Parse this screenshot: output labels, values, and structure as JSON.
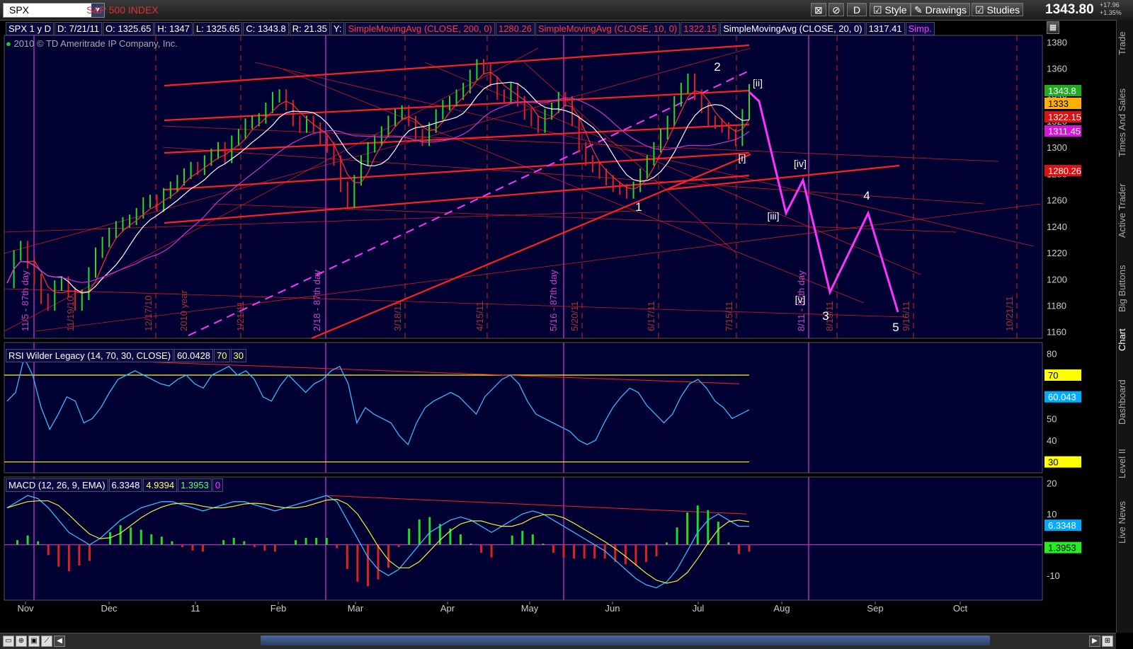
{
  "toolbar": {
    "symbol": "SPX",
    "symbol_name": "S&P 500 INDEX",
    "timeframe_button": "D",
    "style_label": "Style",
    "drawings_label": "Drawings",
    "studies_label": "Studies",
    "last_price": "1343.80",
    "change_abs": "+17.96",
    "change_pct": "+1.35%"
  },
  "header": {
    "symbol_tf": "SPX 1 y D",
    "date": "D: 7/21/11",
    "open": "O: 1325.65",
    "high": "H: 1347",
    "low": "L: 1325.65",
    "close": "C: 1343.8",
    "range": "R: 21.35",
    "y_label": "Y:",
    "sma200_label": "SimpleMovingAvg (CLOSE, 200, 0)",
    "sma200_value": "1280.26",
    "sma10_label": "SimpleMovingAvg (CLOSE, 10, 0)",
    "sma10_value": "1322.15",
    "sma20_label": "SimpleMovingAvg (CLOSE, 20, 0)",
    "sma20_value": "1317.41",
    "more_label": "Simp.",
    "copyright": "2010 © TD Ameritrade IP Company, Inc."
  },
  "rsi_header": {
    "label": "RSI Wilder Legacy (14, 70, 30, CLOSE)",
    "value": "60.0428",
    "ob": "70",
    "os": "30"
  },
  "macd_header": {
    "label": "MACD (12, 26, 9, EMA)",
    "v1": "6.3348",
    "v2": "4.9394",
    "v3": "1.3953",
    "v4": "0"
  },
  "right_tabs": [
    "Trade",
    "Times And Sales",
    "Active Trader",
    "Big Buttons",
    "Chart",
    "Dashboard",
    "Level II",
    "Live News"
  ],
  "price_axis": [
    "1380",
    "1360",
    "1340",
    "1320",
    "1300",
    "1280",
    "1260",
    "1240",
    "1220",
    "1200",
    "1180",
    "1160"
  ],
  "price_flags": [
    {
      "value": "1343.8",
      "color": "#22aa22"
    },
    {
      "value": "1333",
      "color": "#ffb000"
    },
    {
      "value": "1322.15",
      "color": "#dd1111"
    },
    {
      "value": "1311.45",
      "color": "#dd11dd"
    },
    {
      "value": "1280.26",
      "color": "#dd1111"
    }
  ],
  "rsi_axis": [
    "80",
    "70",
    "60",
    "50",
    "40",
    "30"
  ],
  "rsi_flags": [
    {
      "value": "70",
      "color": "#ffff00",
      "text": "#000"
    },
    {
      "value": "60.043",
      "color": "#00aaff",
      "text": "#fff"
    },
    {
      "value": "30",
      "color": "#ffff00",
      "text": "#000"
    }
  ],
  "macd_axis": [
    "20",
    "10",
    "-10"
  ],
  "macd_flags": [
    {
      "value": "6.3348",
      "color": "#00aaff",
      "text": "#fff"
    },
    {
      "value": "1.3953",
      "color": "#22ee22",
      "text": "#000"
    }
  ],
  "months": [
    "Nov",
    "Dec",
    "11",
    "Feb",
    "Mar",
    "Apr",
    "May",
    "Jun",
    "Jul",
    "Aug",
    "Sep",
    "Oct"
  ],
  "date_labels": [
    "11/5 - 87th day",
    "11/19/10",
    "12/17/10",
    "2010 year",
    "1/21/11",
    "2/18 - 87th day",
    "3/18/11",
    "4/15/11",
    "5/16 - 87th day",
    "5/20/11",
    "6/17/11",
    "7/15/11",
    "8/11 - 87th day",
    "8/19/11",
    "9/16/11",
    "10/21/11"
  ],
  "wave_labels": [
    "1",
    "2",
    "3",
    "4",
    "5",
    "[i]",
    "[ii]",
    "[iii]",
    "[iv]",
    "[v]"
  ],
  "colors": {
    "background": "#000033",
    "grid": "#3333aa",
    "trend": "#ff2020",
    "projection": "#ff33ff"
  },
  "chart_data": {
    "type": "line",
    "title": "SPX 1 y D",
    "xlabel": "",
    "ylabel": "",
    "ylim": [
      1155,
      1385
    ],
    "x_months": [
      "Nov",
      "Dec",
      "11",
      "Feb",
      "Mar",
      "Apr",
      "May",
      "Jun",
      "Jul",
      "Aug",
      "Sep",
      "Oct"
    ],
    "close_series": [
      1197,
      1218,
      1225,
      1212,
      1200,
      1185,
      1180,
      1195,
      1198,
      1190,
      1180,
      1188,
      1205,
      1220,
      1228,
      1235,
      1240,
      1243,
      1245,
      1250,
      1258,
      1260,
      1255,
      1265,
      1270,
      1275,
      1280,
      1285,
      1283,
      1290,
      1295,
      1300,
      1292,
      1305,
      1310,
      1318,
      1320,
      1322,
      1330,
      1338,
      1340,
      1332,
      1320,
      1315,
      1320,
      1315,
      1305,
      1300,
      1290,
      1270,
      1258,
      1275,
      1290,
      1300,
      1305,
      1312,
      1320,
      1325,
      1328,
      1320,
      1310,
      1305,
      1315,
      1325,
      1332,
      1335,
      1340,
      1345,
      1355,
      1363,
      1360,
      1350,
      1340,
      1338,
      1345,
      1335,
      1325,
      1320,
      1315,
      1325,
      1330,
      1338,
      1335,
      1320,
      1300,
      1290,
      1285,
      1280,
      1275,
      1270,
      1268,
      1265,
      1270,
      1280,
      1290,
      1300,
      1310,
      1320,
      1335,
      1345,
      1352,
      1340,
      1330,
      1320,
      1318,
      1315,
      1310,
      1305,
      1325,
      1344
    ],
    "projection": [
      {
        "label": "[ii]",
        "y": 1335
      },
      {
        "label": "[iii]",
        "y": 1250
      },
      {
        "label": "[iv]",
        "y": 1275
      },
      {
        "label": "[v]",
        "y": 1190
      },
      {
        "label": "4",
        "y": 1250
      },
      {
        "label": "5",
        "y": 1175
      }
    ],
    "rsi": [
      58,
      62,
      78,
      70,
      55,
      45,
      52,
      60,
      58,
      48,
      50,
      55,
      62,
      68,
      70,
      72,
      70,
      68,
      66,
      65,
      68,
      70,
      66,
      64,
      70,
      72,
      74,
      70,
      72,
      68,
      60,
      58,
      65,
      70,
      66,
      62,
      66,
      68,
      72,
      74,
      66,
      48,
      55,
      52,
      50,
      48,
      42,
      38,
      48,
      55,
      58,
      60,
      62,
      60,
      56,
      52,
      60,
      64,
      68,
      70,
      66,
      58,
      52,
      50,
      48,
      46,
      44,
      40,
      38,
      40,
      48,
      55,
      60,
      64,
      62,
      56,
      52,
      48,
      52,
      60,
      66,
      68,
      64,
      58,
      55,
      50,
      52,
      54
    ],
    "rsi_ylim": [
      25,
      85
    ],
    "macd": [
      12,
      14,
      16,
      15,
      12,
      8,
      4,
      2,
      0,
      2,
      5,
      8,
      10,
      12,
      13,
      14,
      14,
      13,
      12,
      11,
      12,
      13,
      14,
      14,
      13,
      12,
      11,
      12,
      13,
      14,
      15,
      16,
      14,
      8,
      2,
      -4,
      -8,
      -10,
      -8,
      -4,
      0,
      4,
      6,
      8,
      9,
      8,
      6,
      4,
      6,
      8,
      10,
      11,
      10,
      8,
      6,
      4,
      2,
      0,
      -2,
      -5,
      -8,
      -11,
      -13,
      -14,
      -12,
      -8,
      -2,
      4,
      8,
      10,
      8,
      6,
      6
    ],
    "macd_ylim": [
      -18,
      22
    ]
  }
}
